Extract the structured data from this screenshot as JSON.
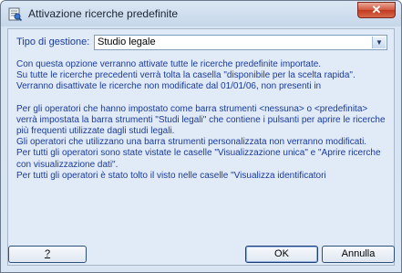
{
  "window": {
    "title": "Attivazione ricerche predefinite",
    "close_label": "✕"
  },
  "form": {
    "tipo_label": "Tipo di gestione:",
    "tipo_value": "Studio legale"
  },
  "info_lines": [
    "Con questa opzione verranno attivate tutte le ricerche predefinite importate.",
    "Su tutte le ricerche precedenti verrà tolta la casella \"disponibile per la scelta rapida\".",
    "Verranno disattivate le ricerche non modificate dal 01/01/06, non presenti in",
    "",
    "Per gli operatori che hanno impostato come barra strumenti <nessuna> o <predefinita> verrà impostata la barra strumenti \"Studi legali\" che contiene i pulsanti per aprire le ricerche più frequenti utilizzate dagli studi legali.",
    "Gli operatori che utilizzano una barra strumenti personalizzata non verranno modificati.",
    "Per tutti gli operatori sono state vistate le caselle \"Visualizzazione unica\" e \"Aprire ricerche con visualizzazione dati\".",
    "Per tutti gli operatori è stato tolto il visto nelle caselle \"Visualizza identificatori"
  ],
  "buttons": {
    "help": "?",
    "ok": "OK",
    "cancel": "Annulla"
  }
}
